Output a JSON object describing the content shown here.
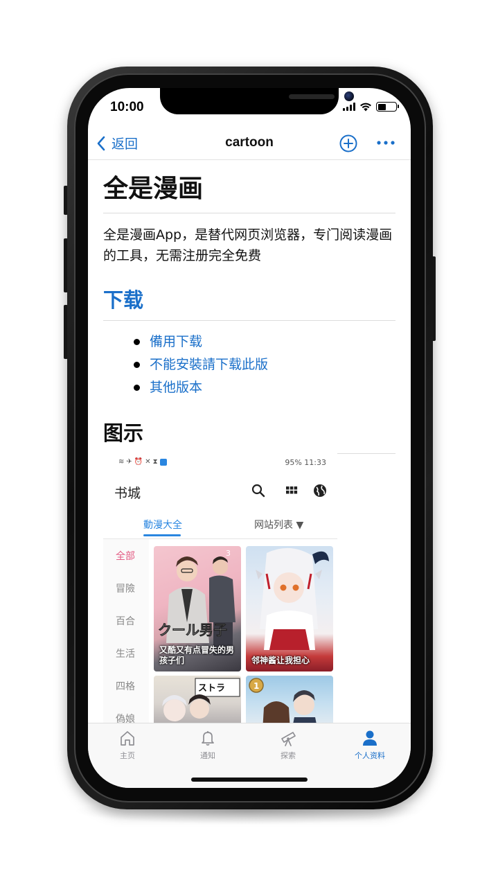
{
  "status_bar": {
    "time": "10:00"
  },
  "nav": {
    "back_label": "返回",
    "title": "cartoon"
  },
  "page": {
    "title": "全是漫画",
    "description": "全是漫画App，是替代网页浏览器，专门阅读漫画的工具，无需注册完全免费",
    "download_heading": "下载",
    "download_links": [
      "備用下载",
      "不能安裝請下载此版",
      "其他版本"
    ],
    "screenshots_heading": "图示"
  },
  "embedded_screenshot": {
    "status_right": "95% 11:33",
    "header_title": "书城",
    "tabs": [
      "動漫大全",
      "网站列表 ▼"
    ],
    "categories": [
      "全部",
      "冒險",
      "百合",
      "生活",
      "四格",
      "偽娘"
    ],
    "active_category": "全部",
    "cards": [
      "又酷又有点冒失的男孩子们",
      "邻神酱让我担心"
    ]
  },
  "tab_bar": {
    "items": [
      {
        "label": "主页",
        "icon": "home-icon"
      },
      {
        "label": "通知",
        "icon": "bell-icon"
      },
      {
        "label": "探索",
        "icon": "telescope-icon"
      },
      {
        "label": "个人资料",
        "icon": "person-icon"
      }
    ],
    "active_index": 3
  },
  "colors": {
    "accent": "#1a6fc9",
    "embed_accent": "#2a86e0",
    "category_active": "#e35c84"
  }
}
